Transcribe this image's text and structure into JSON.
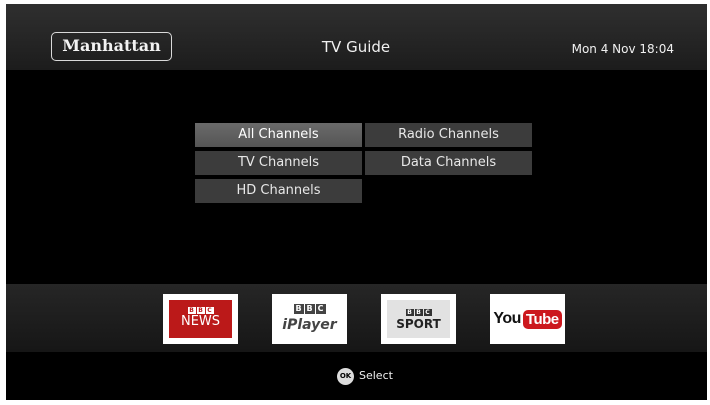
{
  "header": {
    "logo": "Manhattan",
    "title": "TV Guide",
    "datetime": "Mon 4 Nov 18:04"
  },
  "menu": {
    "selected": "All Channels",
    "items": [
      {
        "label": "All Channels"
      },
      {
        "label": "Radio Channels"
      },
      {
        "label": "TV Channels"
      },
      {
        "label": "Data Channels"
      },
      {
        "label": "HD Channels"
      }
    ]
  },
  "apps": {
    "bbc_news": {
      "logo_letters": [
        "B",
        "B",
        "C"
      ],
      "label": "NEWS"
    },
    "bbc_iplayer": {
      "logo_letters": [
        "B",
        "B",
        "C"
      ],
      "label": "iPlayer"
    },
    "bbc_sport": {
      "logo_letters": [
        "B",
        "B",
        "C"
      ],
      "label": "SPORT"
    },
    "youtube": {
      "part1": "You",
      "part2": "Tube"
    }
  },
  "footer": {
    "ok_badge": "OK",
    "action_label": "Select"
  },
  "colors": {
    "background": "#000000",
    "menu_button": "#3c3c3c",
    "menu_selected": "#606060",
    "bbc_news_red": "#bb1919",
    "youtube_red": "#cc181e"
  }
}
